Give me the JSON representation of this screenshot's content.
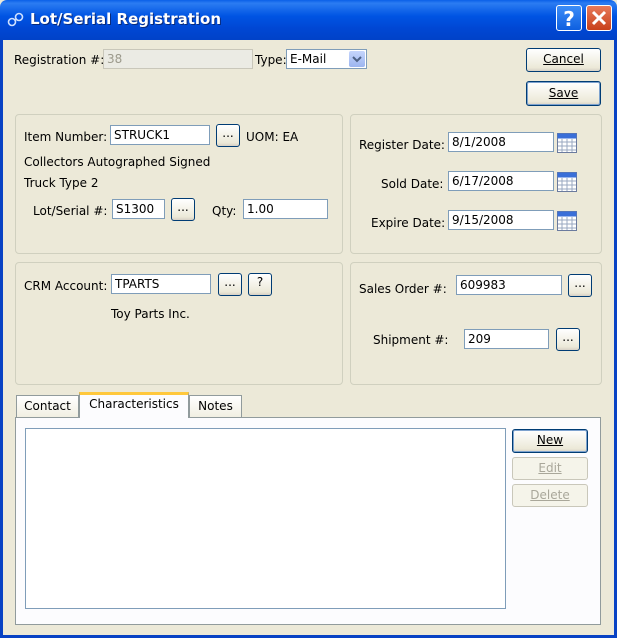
{
  "window": {
    "title": "Lot/Serial Registration",
    "help_label": "?",
    "close_label": "✕"
  },
  "registration": {
    "label": "Registration #:",
    "value": "38",
    "type_label": "Type:",
    "type_value": "E-Mail"
  },
  "buttons": {
    "cancel": "Cancel",
    "save": "Save",
    "lookup": "...",
    "question": "?",
    "new": "New",
    "edit": "Edit",
    "delete": "Delete"
  },
  "item": {
    "item_number_label": "Item Number:",
    "item_number": "STRUCK1",
    "uom": "UOM: EA",
    "description1": "Collectors Autographed Signed",
    "description2": "Truck Type 2",
    "lot_label": "Lot/Serial #:",
    "lot_value": "S1300",
    "qty_label": "Qty:",
    "qty_value": "1.00"
  },
  "dates": {
    "register_label": "Register Date:",
    "register_value": "8/1/2008",
    "sold_label": "Sold Date:",
    "sold_value": "6/17/2008",
    "expire_label": "Expire Date:",
    "expire_value": "9/15/2008"
  },
  "crm": {
    "label": "CRM Account:",
    "value": "TPARTS",
    "name": "Toy Parts Inc."
  },
  "order": {
    "sales_label": "Sales Order #:",
    "sales_value": "609983",
    "shipment_label": "Shipment #:",
    "shipment_value": "209"
  },
  "tabs": [
    {
      "label": "Contact"
    },
    {
      "label": "Characteristics"
    },
    {
      "label": "Notes"
    }
  ],
  "colors": {
    "titlebar": "#0054e3",
    "window_bg": "#ece9d8",
    "active_tab_accent": "#ffc83c"
  }
}
